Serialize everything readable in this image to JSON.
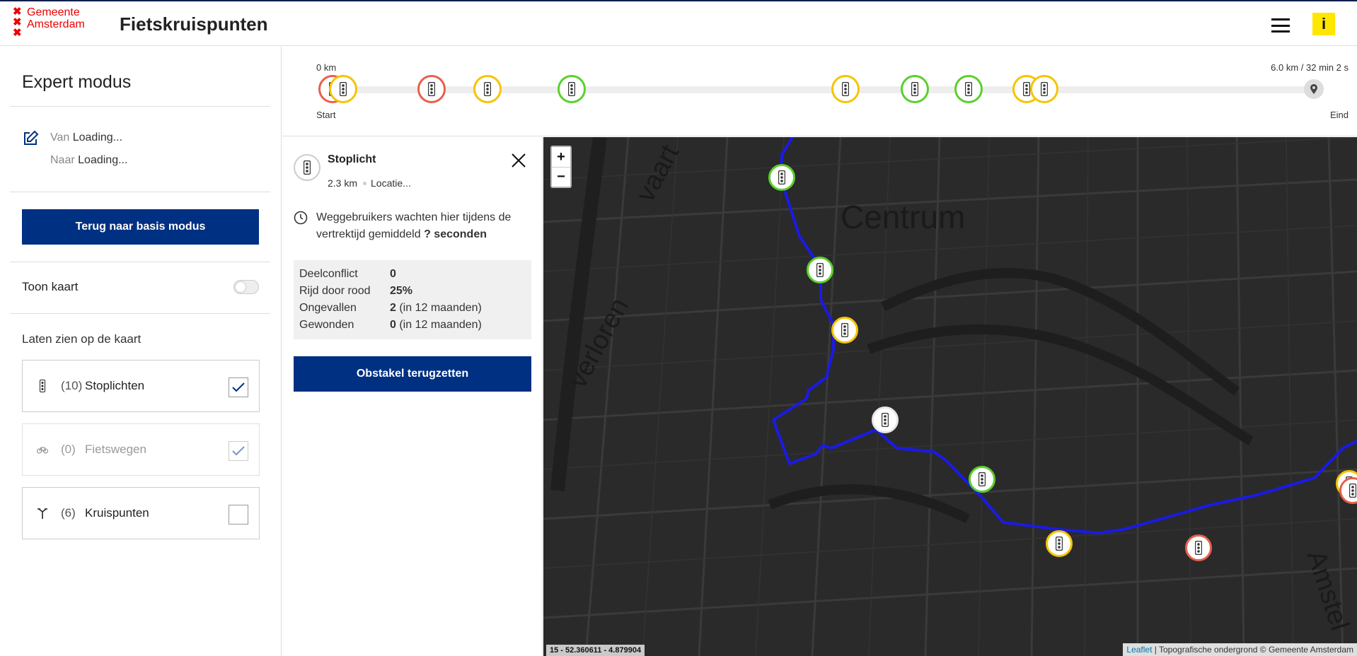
{
  "header": {
    "logo_cross": "✖",
    "logo_line1": "Gemeente",
    "logo_line2": "Amsterdam",
    "title": "Fietskruispunten",
    "info_label": "i"
  },
  "sidebar": {
    "title": "Expert modus",
    "van_label": "Van",
    "van_value": "Loading...",
    "naar_label": "Naar",
    "naar_value": "Loading...",
    "back_button": "Terug naar basis modus",
    "toggle_label": "Toon kaart",
    "toggle_on": false,
    "show_label": "Laten zien op de kaart",
    "filters": [
      {
        "count": "(10)",
        "name": "Stoplichten",
        "checked": true,
        "icon": "traffic-light-icon"
      },
      {
        "count": "(0)",
        "name": "Fietswegen",
        "checked": true,
        "icon": "bicycle-icon"
      },
      {
        "count": "(6)",
        "name": "Kruispunten",
        "checked": false,
        "icon": "junction-icon"
      }
    ]
  },
  "timeline": {
    "start_km": "0 km",
    "start_label": "Start",
    "end_summary": "6.0 km / 32 min 2 s",
    "end_label": "Eind",
    "end_icon": "location-pin-icon"
  },
  "detail": {
    "title": "Stoplicht",
    "distance": "2.3 km",
    "location": "Locatie...",
    "wait_text": "Weggebruikers wachten hier tijdens de vertrektijd gemiddeld",
    "wait_value": "? seconden",
    "stats": [
      {
        "key": "Deelconflict",
        "value": "0",
        "suffix": ""
      },
      {
        "key": "Rijd door rood",
        "value": "25%",
        "suffix": ""
      },
      {
        "key": "Ongevallen",
        "value": "2",
        "suffix": " (in 12 maanden)"
      },
      {
        "key": "Gewonden",
        "value": "0",
        "suffix": " (in 12 maanden)"
      }
    ],
    "reset_button": "Obstakel terugzetten"
  },
  "map": {
    "zoom_in": "+",
    "zoom_out": "−",
    "label_centrum": "Centrum",
    "label_verloren": "verloren",
    "label_vaart": "vaart",
    "label_amstel": "Amstel",
    "coords": "15 - 52.360611  - 4.879904",
    "attrib_leaflet": "Leaflet",
    "attrib_rest": " | Topografische ondergrond © Gemeente Amsterdam"
  },
  "colors": {
    "brand_blue": "#003082",
    "red": "#e8604c",
    "yellow": "#f5c400",
    "green": "#5bd02c",
    "route": "#1a1ae6",
    "highlight": "#e8e8e8"
  }
}
